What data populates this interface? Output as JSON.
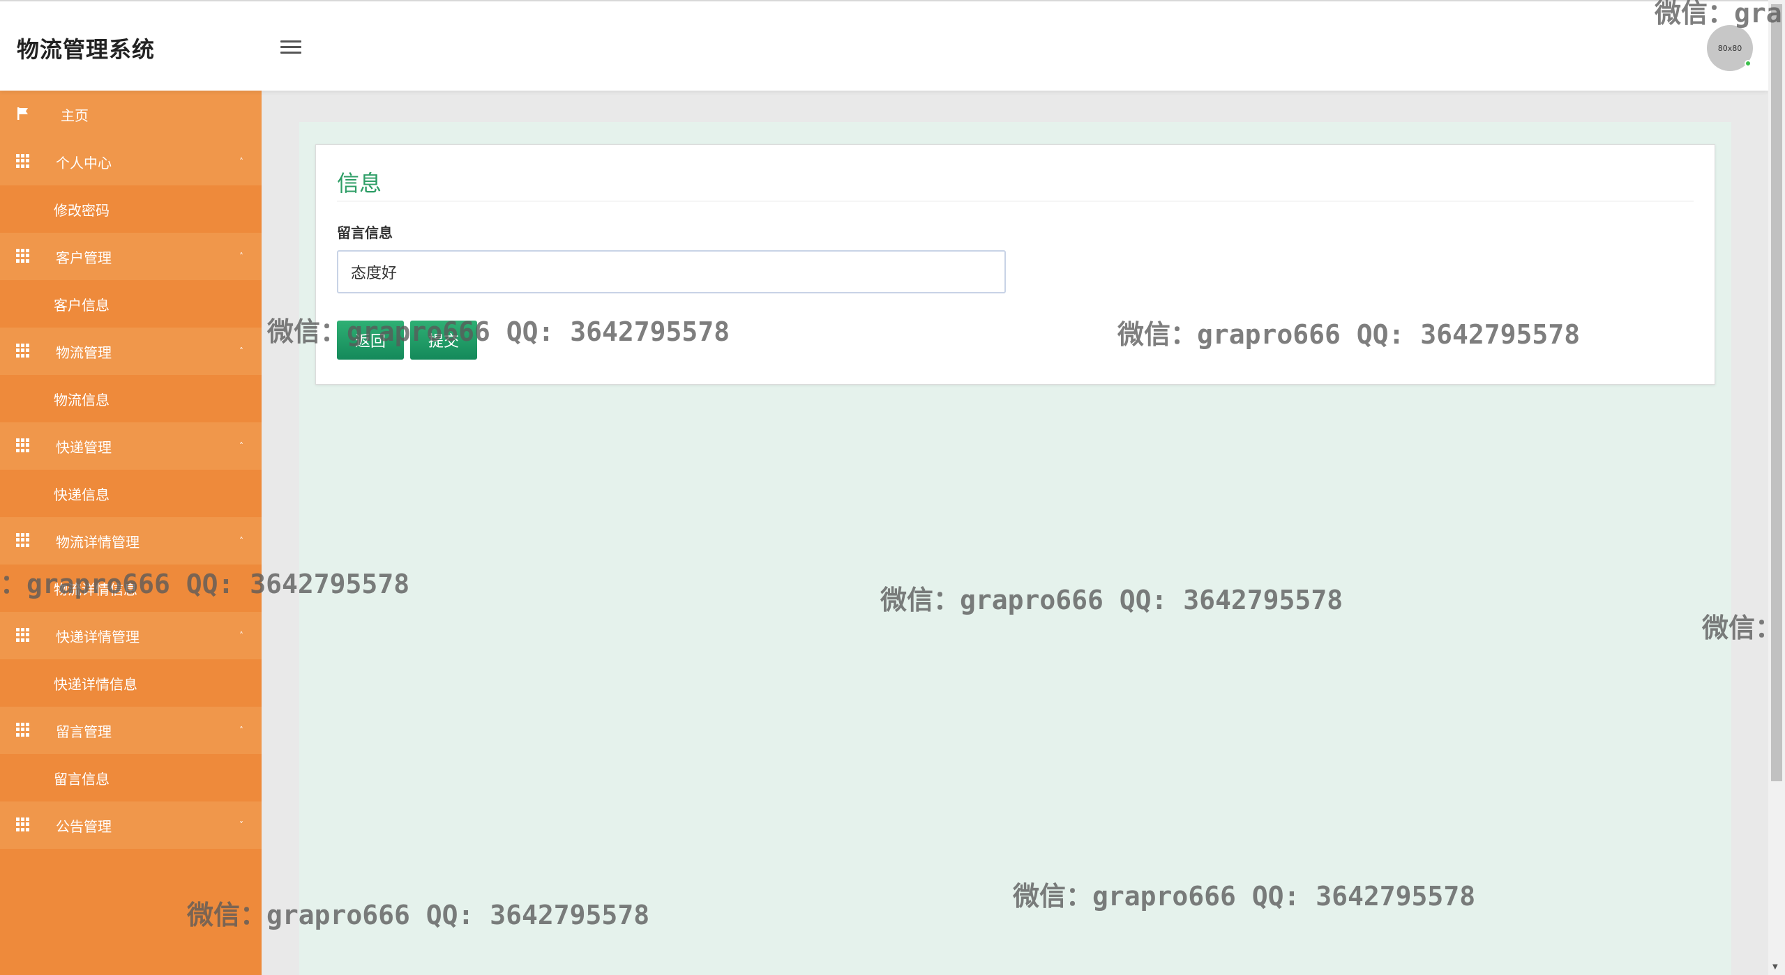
{
  "header": {
    "brand": "物流管理系统",
    "avatar_text": "80x80"
  },
  "sidebar": {
    "items": [
      {
        "label": "主页",
        "type": "home",
        "icon": "flag-icon"
      },
      {
        "label": "个人中心",
        "type": "parent",
        "icon": "grid-icon",
        "caret": "˄"
      },
      {
        "label": "修改密码",
        "type": "sub"
      },
      {
        "label": "客户管理",
        "type": "parent",
        "icon": "grid-icon",
        "caret": "˄"
      },
      {
        "label": "客户信息",
        "type": "sub"
      },
      {
        "label": "物流管理",
        "type": "parent",
        "icon": "grid-icon",
        "caret": "˄"
      },
      {
        "label": "物流信息",
        "type": "sub"
      },
      {
        "label": "快递管理",
        "type": "parent",
        "icon": "grid-icon",
        "caret": "˄"
      },
      {
        "label": "快递信息",
        "type": "sub"
      },
      {
        "label": "物流详情管理",
        "type": "parent",
        "icon": "grid-icon",
        "caret": "˄"
      },
      {
        "label": "物流详情信息",
        "type": "sub"
      },
      {
        "label": "快递详情管理",
        "type": "parent",
        "icon": "grid-icon",
        "caret": "˄"
      },
      {
        "label": "快递详情信息",
        "type": "sub"
      },
      {
        "label": "留言管理",
        "type": "parent",
        "icon": "grid-icon",
        "caret": "˄"
      },
      {
        "label": "留言信息",
        "type": "sub"
      },
      {
        "label": "公告管理",
        "type": "parent",
        "icon": "grid-icon",
        "caret": "˅"
      }
    ]
  },
  "main": {
    "card_title": "信息",
    "field_label": "留言信息",
    "field_value": "态度好",
    "back_button": "返回",
    "submit_button": "提交"
  },
  "watermark": {
    "text": "微信：grapro666 QQ: 3642795578",
    "partial_top_right": "微信：gra",
    "partial_right": "微信：",
    "partial_left": "：grapro666 QQ: 3642795578"
  },
  "colors": {
    "sidebar": "#ee8a3b",
    "sidebar_parent": "#f0974b",
    "accent_green": "#2e9e66",
    "content_bg": "#e5f2ec"
  }
}
